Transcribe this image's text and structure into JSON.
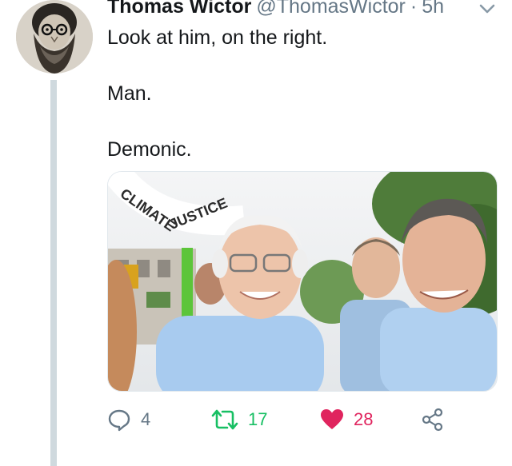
{
  "tweet": {
    "author_name": "Thomas Wictor",
    "author_handle": "@ThomasWictor",
    "separator": "·",
    "timestamp": "5h",
    "text_lines": [
      "Look at him, on the right.",
      "",
      "Man.",
      "",
      "Demonic."
    ],
    "media": {
      "sign_text_1": "CLIMATE",
      "sign_text_2": "JUSTICE"
    }
  },
  "actions": {
    "reply_count": "4",
    "retweet_count": "17",
    "like_count": "28"
  },
  "colors": {
    "retweet_active": "#17bf63",
    "like_active": "#e0245e",
    "muted": "#657786",
    "thread_line": "#cfd9de"
  },
  "icons": [
    "reply-icon",
    "retweet-icon",
    "heart-icon",
    "share-icon",
    "chevron-down-icon"
  ]
}
